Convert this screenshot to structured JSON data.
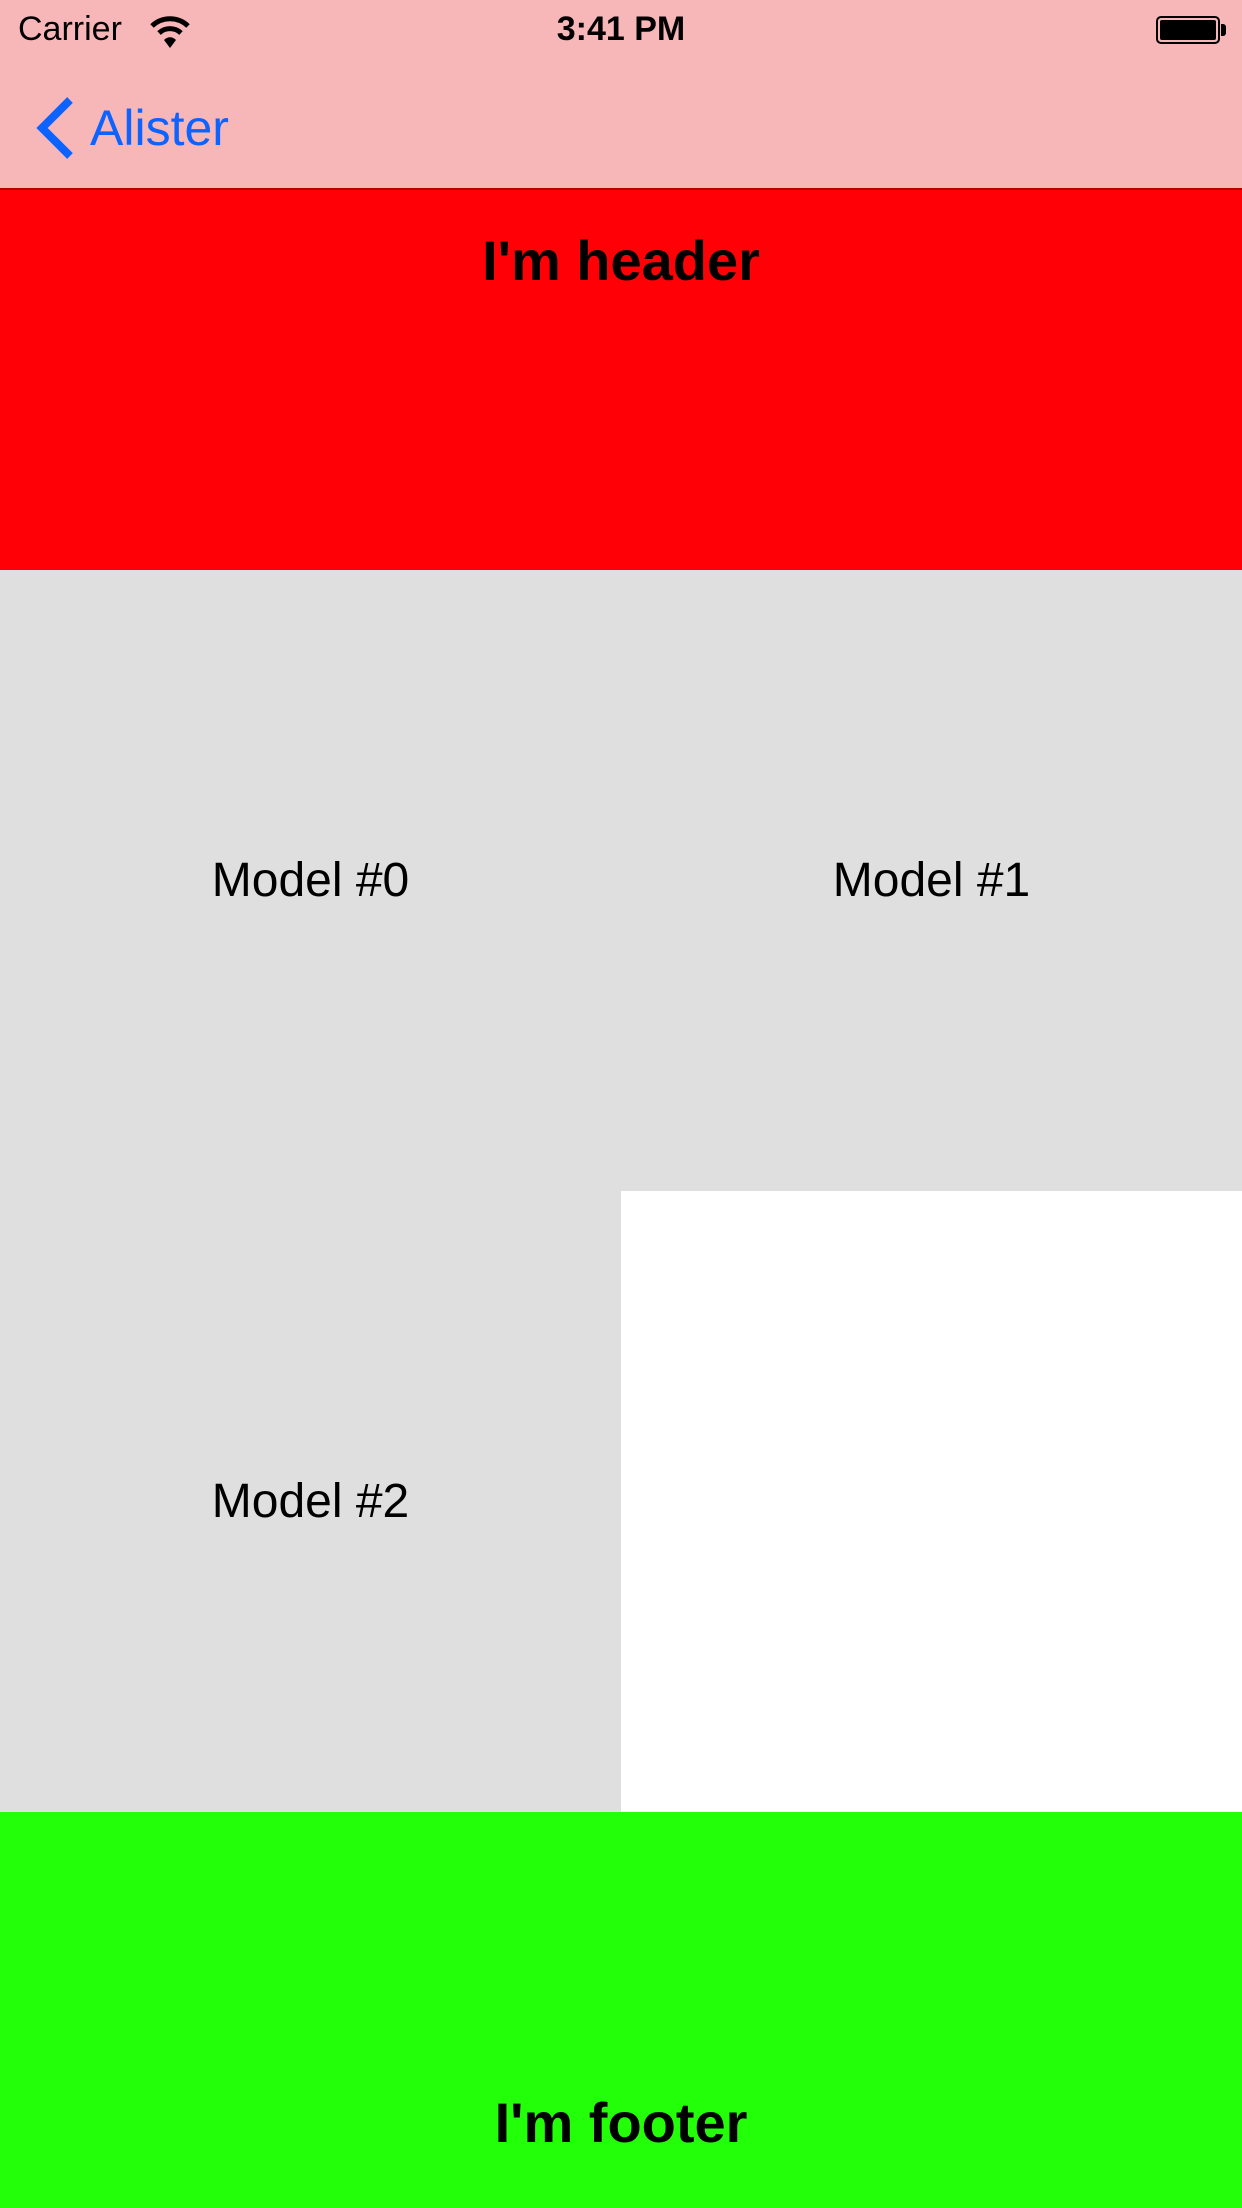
{
  "status_bar": {
    "carrier": "Carrier",
    "time": "3:41 PM",
    "wifi_icon": "wifi-icon",
    "battery_icon": "battery-icon"
  },
  "nav": {
    "back_label": "Alister",
    "back_icon": "chevron-left-icon"
  },
  "header": {
    "title": "I'm header"
  },
  "cells": [
    {
      "label": "Model #0"
    },
    {
      "label": "Model #1"
    },
    {
      "label": "Model #2"
    }
  ],
  "footer": {
    "title": "I'm footer"
  },
  "colors": {
    "nav_bg": "#f7b7b9",
    "accent": "#0d63ff",
    "header_bg": "#fe0006",
    "cell_bg": "#dfdfdf",
    "footer_bg": "#23ff09"
  }
}
